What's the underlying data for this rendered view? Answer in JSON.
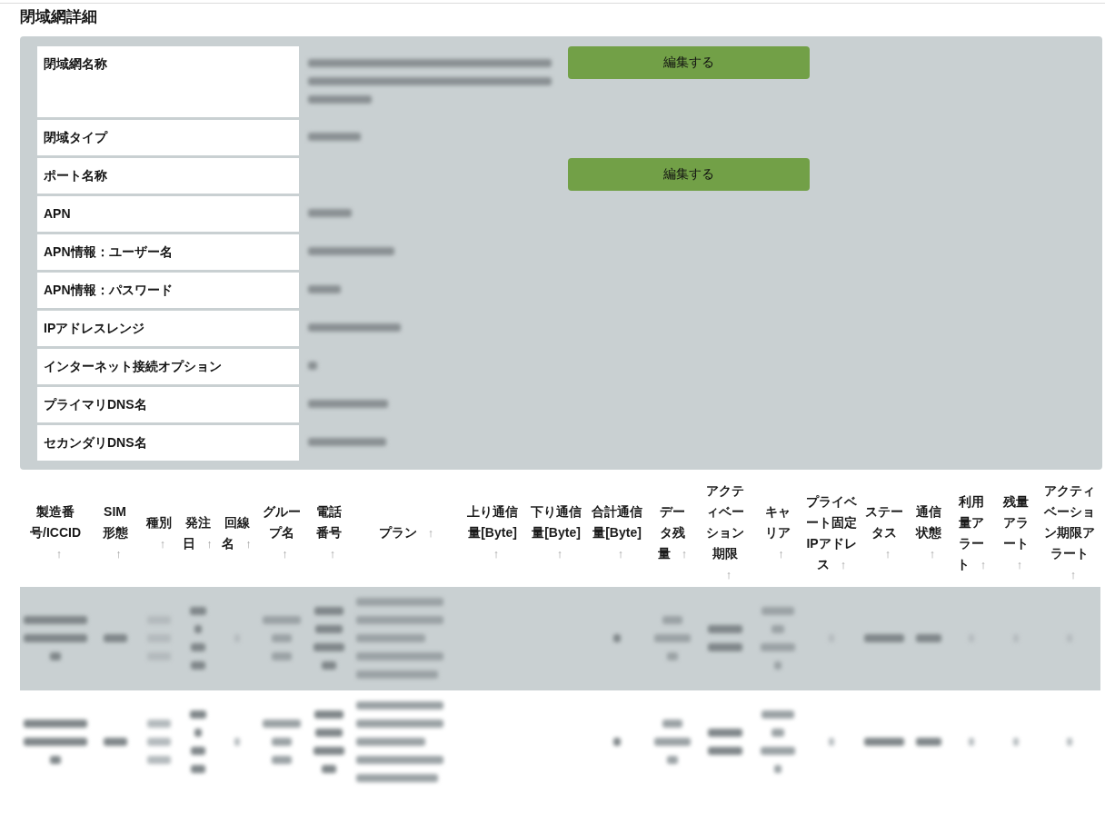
{
  "title": "閉域網詳細",
  "details": [
    {
      "label": "閉域網名称",
      "value_redacted": true,
      "edit_button": "編集する"
    },
    {
      "label": "閉域タイプ",
      "value_redacted": true
    },
    {
      "label": "ポート名称",
      "value_redacted": false,
      "edit_button": "編集する"
    },
    {
      "label": "APN",
      "value_redacted": true
    },
    {
      "label": "APN情報：ユーザー名",
      "value_redacted": true
    },
    {
      "label": "APN情報：パスワード",
      "value_redacted": true
    },
    {
      "label": "IPアドレスレンジ",
      "value_redacted": true
    },
    {
      "label": "インターネット接続オプション",
      "value_redacted": true
    },
    {
      "label": "プライマリDNS名",
      "value_redacted": true
    },
    {
      "label": "セカンダリDNS名",
      "value_redacted": true
    }
  ],
  "table": {
    "columns": [
      {
        "label": "製造番号/ICCID",
        "sort": "↑"
      },
      {
        "label": "SIM形態",
        "sort": "↑"
      },
      {
        "label": "種別",
        "sort": "↑"
      },
      {
        "label": "発注日",
        "sort": "↑"
      },
      {
        "label": "回線名",
        "sort": "↑"
      },
      {
        "label": "グループ名",
        "sort": "↑"
      },
      {
        "label": "電話番号",
        "sort": "↑"
      },
      {
        "label": "プラン",
        "sort": "↑"
      },
      {
        "label": "上り通信量[Byte]",
        "sort": "↑"
      },
      {
        "label": "下り通信量[Byte]",
        "sort": "↑"
      },
      {
        "label": "合計通信量[Byte]",
        "sort": "↑"
      },
      {
        "label": "データ残量",
        "sort": "↑"
      },
      {
        "label": "アクティベーション期限",
        "sort": "↑"
      },
      {
        "label": "キャリア",
        "sort": "↑"
      },
      {
        "label": "プライベート固定IPアドレス",
        "sort": "↑"
      },
      {
        "label": "ステータス",
        "sort": "↑"
      },
      {
        "label": "通信状態",
        "sort": "↑"
      },
      {
        "label": "利用量アラート",
        "sort": "↑"
      },
      {
        "label": "残量アラート",
        "sort": "↑"
      },
      {
        "label": "アクティベーション期限アラート",
        "sort": "↑"
      }
    ],
    "rows": [
      {
        "selected": true,
        "cells": [
          {
            "redacted": true
          },
          {
            "redacted": true
          },
          {
            "redacted": true
          },
          {
            "redacted": true
          },
          {
            "redacted": true
          },
          {
            "redacted": true
          },
          {
            "redacted": true
          },
          {
            "redacted": true
          },
          {
            "redacted": false
          },
          {
            "redacted": false
          },
          {
            "redacted": true
          },
          {
            "redacted": true
          },
          {
            "redacted": true
          },
          {
            "redacted": true
          },
          {
            "redacted": true
          },
          {
            "redacted": true
          },
          {
            "redacted": true
          },
          {
            "redacted": true
          },
          {
            "redacted": true
          },
          {
            "redacted": true
          }
        ]
      },
      {
        "selected": false,
        "cells": [
          {
            "redacted": true
          },
          {
            "redacted": true
          },
          {
            "redacted": true
          },
          {
            "redacted": true
          },
          {
            "redacted": true
          },
          {
            "redacted": true
          },
          {
            "redacted": true
          },
          {
            "redacted": true
          },
          {
            "redacted": false
          },
          {
            "redacted": false
          },
          {
            "redacted": true
          },
          {
            "redacted": true
          },
          {
            "redacted": true
          },
          {
            "redacted": true
          },
          {
            "redacted": true
          },
          {
            "redacted": true
          },
          {
            "redacted": true
          },
          {
            "redacted": true
          },
          {
            "redacted": true
          },
          {
            "redacted": true
          }
        ]
      }
    ]
  }
}
